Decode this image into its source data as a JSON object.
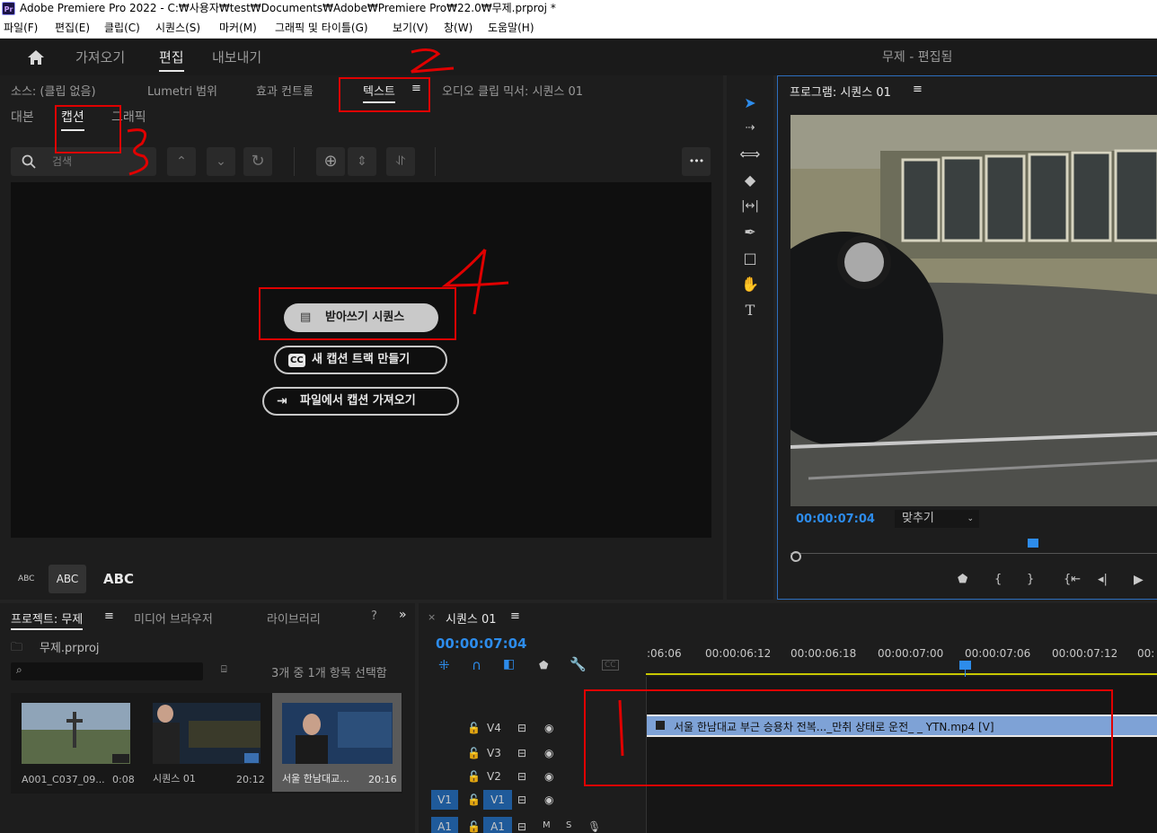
{
  "app": {
    "logo": "Pr",
    "title": "Adobe Premiere Pro 2022 - C:₩사용자₩test₩Documents₩Adobe₩Premiere Pro₩22.0₩무제.prproj *"
  },
  "menu": [
    "파일(F)",
    "편집(E)",
    "클립(C)",
    "시퀀스(S)",
    "마커(M)",
    "그래픽 및 타이틀(G)",
    "보기(V)",
    "창(W)",
    "도움말(H)"
  ],
  "workspace": {
    "tabs": [
      "가져오기",
      "편집",
      "내보내기"
    ],
    "active": "편집",
    "title": "무제 - 편집됨",
    "home_icon": "home-icon"
  },
  "source_panel": {
    "tabs": [
      "소스: (클립 없음)",
      "Lumetri 범위",
      "효과 컨트롤",
      "텍스트",
      "오디오 클립 믹서: 시퀀스 01"
    ],
    "active": "텍스트",
    "menu_icon": "≡"
  },
  "text_panel": {
    "subtabs": [
      "대본",
      "캡션",
      "그래픽"
    ],
    "active_subtab": "캡션",
    "search_placeholder": "검색",
    "buttons": {
      "transcribe": "받아쓰기 시퀀스",
      "new_caption_track": "새 캡션 트랙 만들기",
      "import_captions": "파일에서 캡션 가져오기"
    },
    "cc_badge": "CC",
    "more": "•••",
    "abc_sizes": [
      "ABC",
      "ABC",
      "ABC"
    ]
  },
  "annotations": [
    "2",
    "3",
    "4",
    "1"
  ],
  "program_monitor": {
    "title": "프로그램: 시퀀스 01",
    "timecode": "00:00:07:04",
    "fit": "맞추기"
  },
  "project_panel": {
    "tabs": [
      "프로젝트: 무제",
      "미디어 브라우저",
      "라이브러리",
      "?"
    ],
    "project_file": "무제.prproj",
    "selection_status": "3개 중 1개 항목 선택함",
    "items": [
      {
        "name": "A001_C037_09...",
        "duration": "0:08"
      },
      {
        "name": "시퀀스 01",
        "duration": "20:12"
      },
      {
        "name": "서울 한남대교...",
        "duration": "20:16"
      }
    ]
  },
  "timeline": {
    "tab": "시퀀스 01",
    "timecode": "00:00:07:04",
    "ruler": [
      ":06:06",
      "00:00:06:12",
      "00:00:06:18",
      "00:00:07:00",
      "00:00:07:06",
      "00:00:07:12",
      "00:"
    ],
    "tracks": [
      "V4",
      "V3",
      "V2",
      "V1",
      "A1"
    ],
    "source_patch": [
      "V1",
      "A1"
    ],
    "clip": "서울 한남대교 부근 승용차 전복..._만취 상태로 운전_ _ YTN.mp4 [V]",
    "audio_labels": [
      "M",
      "S"
    ]
  }
}
